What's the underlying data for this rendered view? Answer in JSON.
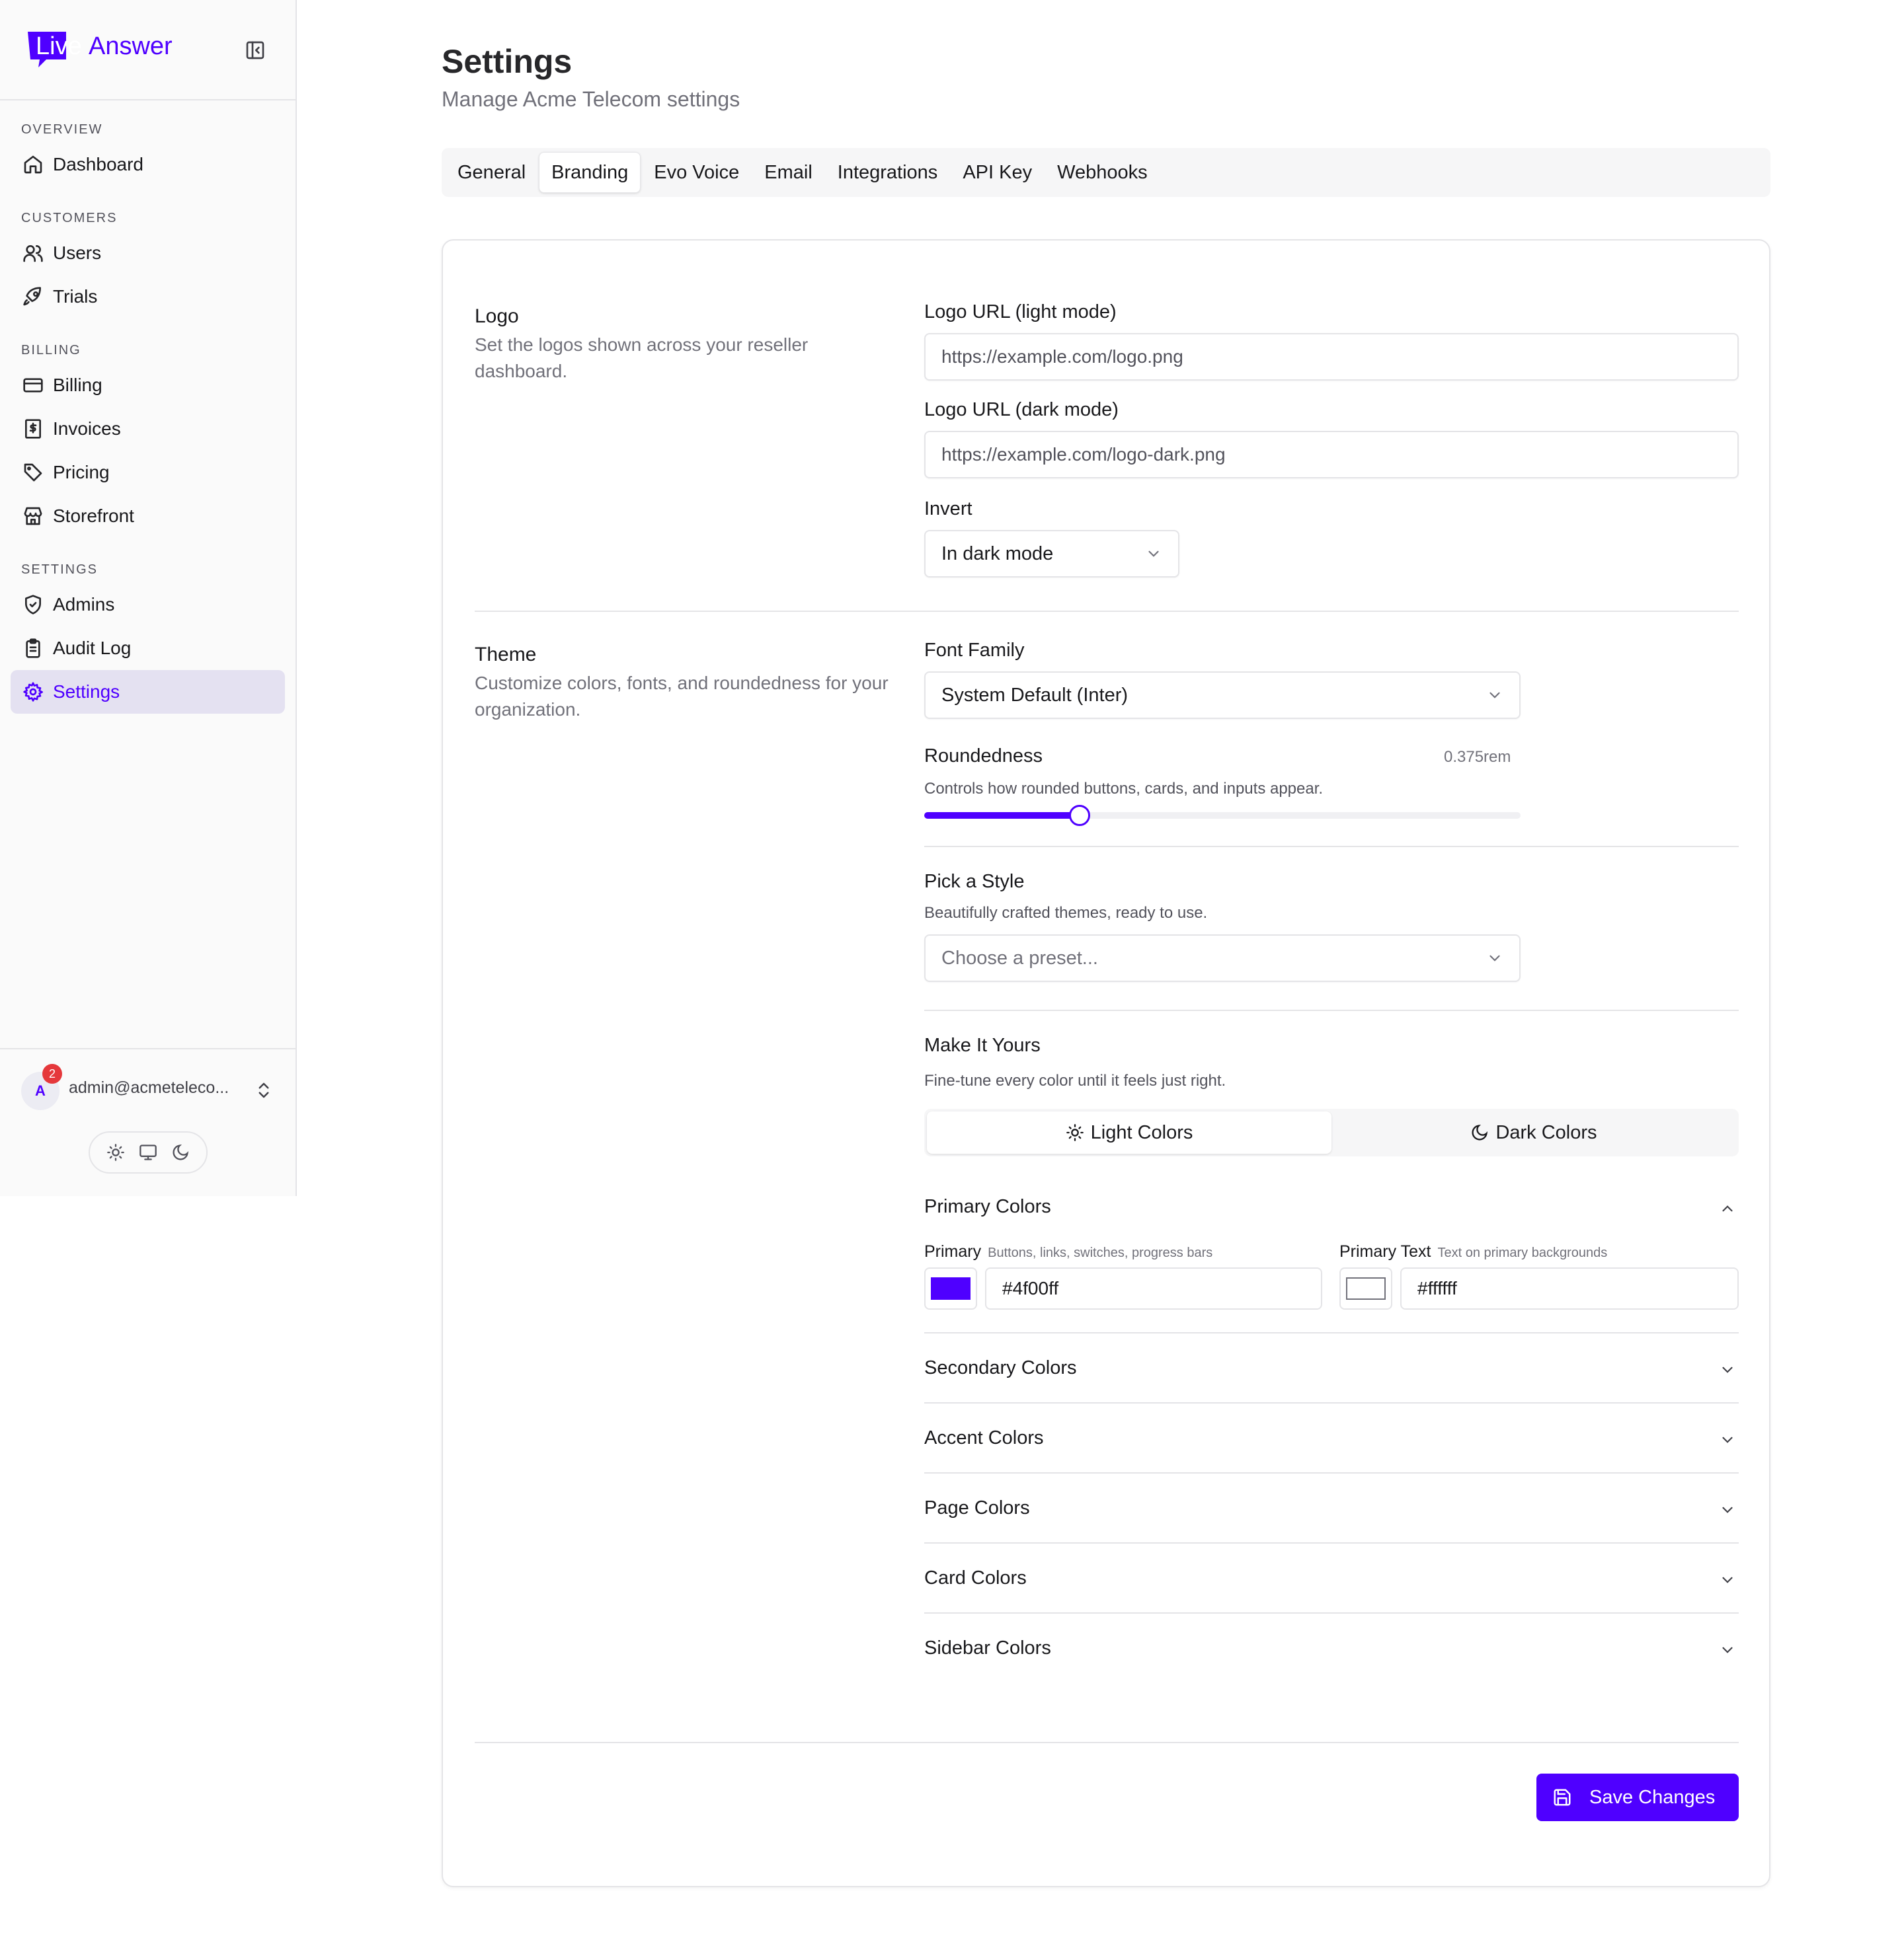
{
  "brand": {
    "logo_text_part1": "Live",
    "logo_text_part2": "Answer",
    "accent": "#4f00ff"
  },
  "sidebar": {
    "groups": [
      {
        "label": "OVERVIEW",
        "items": [
          {
            "label": "Dashboard",
            "icon": "home-icon"
          }
        ]
      },
      {
        "label": "CUSTOMERS",
        "items": [
          {
            "label": "Users",
            "icon": "users-icon"
          },
          {
            "label": "Trials",
            "icon": "rocket-icon"
          }
        ]
      },
      {
        "label": "BILLING",
        "items": [
          {
            "label": "Billing",
            "icon": "credit-card-icon"
          },
          {
            "label": "Invoices",
            "icon": "receipt-icon"
          },
          {
            "label": "Pricing",
            "icon": "tag-icon"
          },
          {
            "label": "Storefront",
            "icon": "store-icon"
          }
        ]
      },
      {
        "label": "SETTINGS",
        "items": [
          {
            "label": "Admins",
            "icon": "shield-icon"
          },
          {
            "label": "Audit Log",
            "icon": "clipboard-icon"
          },
          {
            "label": "Settings",
            "icon": "gear-icon",
            "active": true
          }
        ]
      }
    ],
    "user": {
      "initial": "A",
      "badge": "2",
      "email": "admin@acmeteleco..."
    }
  },
  "page": {
    "title": "Settings",
    "subtitle": "Manage Acme Telecom settings"
  },
  "tabs": [
    "General",
    "Branding",
    "Evo Voice",
    "Email",
    "Integrations",
    "API Key",
    "Webhooks"
  ],
  "active_tab": "Branding",
  "logo_section": {
    "title": "Logo",
    "description": "Set the logos shown across your reseller dashboard.",
    "light_label": "Logo URL (light mode)",
    "light_placeholder": "https://example.com/logo.png",
    "dark_label": "Logo URL (dark mode)",
    "dark_placeholder": "https://example.com/logo-dark.png",
    "invert_label": "Invert",
    "invert_value": "In dark mode"
  },
  "theme_section": {
    "title": "Theme",
    "description": "Customize colors, fonts, and roundedness for your organization.",
    "font_label": "Font Family",
    "font_value": "System Default (Inter)",
    "round_label": "Roundedness",
    "round_value": "0.375rem",
    "round_desc": "Controls how rounded buttons, cards, and inputs appear.",
    "round_fraction": 0.26,
    "style_label": "Pick a Style",
    "style_desc": "Beautifully crafted themes, ready to use.",
    "style_placeholder": "Choose a preset...",
    "yours_label": "Make It Yours",
    "yours_desc": "Fine-tune every color until it feels just right.",
    "light_colors": "Light Colors",
    "dark_colors": "Dark Colors",
    "primary_group": "Primary Colors",
    "primary_label": "Primary",
    "primary_hint": "Buttons, links, switches, progress bars",
    "primary_value": "#4f00ff",
    "primary_text_label": "Primary Text",
    "primary_text_hint": "Text on primary backgrounds",
    "primary_text_value": "#ffffff",
    "groups": [
      "Secondary Colors",
      "Accent Colors",
      "Page Colors",
      "Card Colors",
      "Sidebar Colors"
    ]
  },
  "actions": {
    "save": "Save Changes"
  }
}
